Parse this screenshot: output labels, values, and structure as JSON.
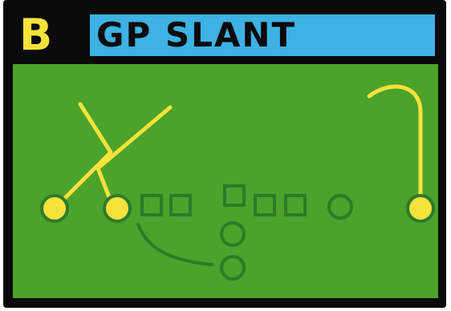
{
  "play": {
    "formation_letter": "B",
    "name": "GP SLANT"
  },
  "colors": {
    "background": "#0a0a0a",
    "title_bar": "#3db2e3",
    "letter": "#f5e23a",
    "field": "#4ca22b",
    "route_highlight": "#f5e23a",
    "route_shadow": "#2e7a2a",
    "lineman": "#2e7a2a"
  },
  "icons": {
    "receiver": "filled-yellow-circle",
    "lineman": "square-outline",
    "back": "circle-outline"
  }
}
